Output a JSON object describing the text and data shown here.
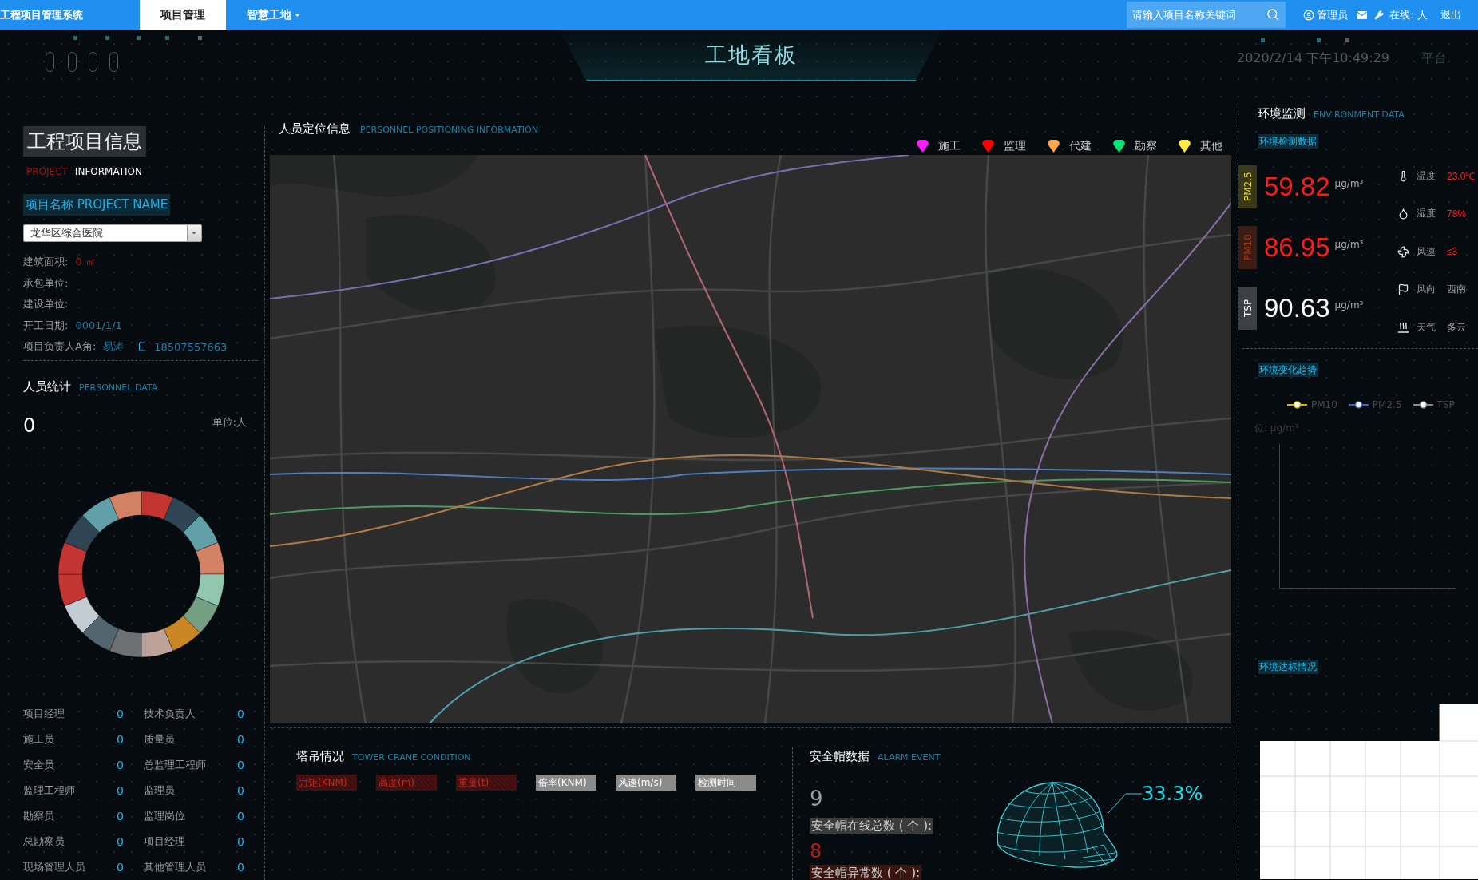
{
  "nav": {
    "brand": "工程项目管理系统",
    "tabs": [
      {
        "label": "项目管理",
        "selected": true,
        "dropdown": false
      },
      {
        "label": "智慧工地",
        "selected": false,
        "dropdown": true
      }
    ],
    "search": {
      "placeholder": "请输入项目名称关键词"
    },
    "user": "管理员",
    "online": "在线: 人",
    "logout": "退出"
  },
  "header": {
    "title": "工地看板",
    "datetime": "2020/2/14 下午10:49:29",
    "corner": "平台"
  },
  "project_info": {
    "title": "工程项目信息",
    "subtitle_lead": "PROJECT",
    "subtitle_rest": "INFORMATION",
    "name_label": "项目名称 PROJECT NAME",
    "project_select": {
      "value": "龙华区综合医院"
    },
    "fields": [
      {
        "label": "建筑面积:",
        "value": "0 ㎡",
        "kind": "warning"
      },
      {
        "label": "承包单位:"
      },
      {
        "label": "建设单位:"
      },
      {
        "label": "开工日期:",
        "value": "0001/1/1",
        "kind": "info"
      },
      {
        "label": "项目负责人A角:",
        "value": "易涛",
        "phone": "18507557663",
        "kind": "info"
      }
    ]
  },
  "personnel": {
    "title": "人员统计",
    "subtitle": "PERSONNEL DATA",
    "total": "0",
    "unit": "单位:人",
    "roles": [
      {
        "label": "项目经理",
        "count": "0"
      },
      {
        "label": "技术负责人",
        "count": "0"
      },
      {
        "label": "施工员",
        "count": "0"
      },
      {
        "label": "质量员",
        "count": "0"
      },
      {
        "label": "安全员",
        "count": "0"
      },
      {
        "label": "总监理工程师",
        "count": "0"
      },
      {
        "label": "监理工程师",
        "count": "0"
      },
      {
        "label": "监理员",
        "count": "0"
      },
      {
        "label": "勘察员",
        "count": "0"
      },
      {
        "label": "监理岗位",
        "count": "0"
      },
      {
        "label": "总勘察员",
        "count": "0"
      },
      {
        "label": "项目经理",
        "count": "0"
      },
      {
        "label": "现场管理人员",
        "count": "0"
      },
      {
        "label": "其他管理人员",
        "count": "0"
      }
    ]
  },
  "positioning": {
    "title": "人员定位信息",
    "subtitle": "PERSONNEL POSITIONING INFORMATION",
    "legend": [
      {
        "label": "施工",
        "color": "#ff1aff"
      },
      {
        "label": "监理",
        "color": "#ff0000"
      },
      {
        "label": "代建",
        "color": "#ffa64d"
      },
      {
        "label": "勘察",
        "color": "#00e676"
      },
      {
        "label": "其他",
        "color": "#ffeb3b"
      }
    ]
  },
  "tower_crane": {
    "title": "塔吊情况",
    "subtitle": "TOWER CRANE CONDITION",
    "columns": [
      {
        "label": "力矩(KNM)",
        "alert": true
      },
      {
        "label": "高度(m)",
        "alert": true
      },
      {
        "label": "重量(t)",
        "alert": true
      },
      {
        "label": "倍率(KNM)",
        "alert": false
      },
      {
        "label": "风速(m/s)",
        "alert": false
      },
      {
        "label": "检测时间",
        "alert": false
      }
    ]
  },
  "helmet": {
    "title": "安全帽数据",
    "subtitle": "ALARM EVENT",
    "online_count": "9",
    "online_label": "安全帽在线总数 ( 个 ):",
    "abnormal_count": "8",
    "abnormal_label": "安全帽异常数 ( 个 ):",
    "ratio": "33.3%"
  },
  "environment": {
    "title": "环境监测",
    "subtitle": "ENVIRONMENT DATA",
    "data_tag": "环境检测数据",
    "readings": [
      {
        "kind": "pm25",
        "name": "PM2.5",
        "value": "59.82",
        "unit": "μg/m³",
        "exceeded": true
      },
      {
        "kind": "pm10",
        "name": "PM10",
        "value": "86.95",
        "unit": "μg/m³",
        "exceeded": true
      },
      {
        "kind": "tsp",
        "name": "TSP",
        "value": "90.63",
        "unit": "μg/m³",
        "exceeded": false
      }
    ],
    "weather": [
      {
        "kind": "temperature",
        "label": "温度",
        "value": "23.0℃",
        "alert": true
      },
      {
        "kind": "humidity",
        "label": "湿度",
        "value": "78%",
        "alert": true
      },
      {
        "kind": "wind_speed",
        "label": "风速",
        "value": "≤3",
        "alert": true
      },
      {
        "kind": "wind_direction",
        "label": "风向",
        "value": "西南",
        "alert": false
      },
      {
        "kind": "sky",
        "label": "天气",
        "value": "多云",
        "alert": false
      }
    ],
    "trend_tag": "环境变化趋势",
    "trend_legend": [
      {
        "label": "PM10",
        "color": "#d4b800"
      },
      {
        "label": "PM2.5",
        "color": "#3f63c8"
      },
      {
        "label": "TSP",
        "color": "#8a8a8a"
      }
    ],
    "trend_unit": "位: μg/m³",
    "standard_tag": "环境达标情况"
  }
}
